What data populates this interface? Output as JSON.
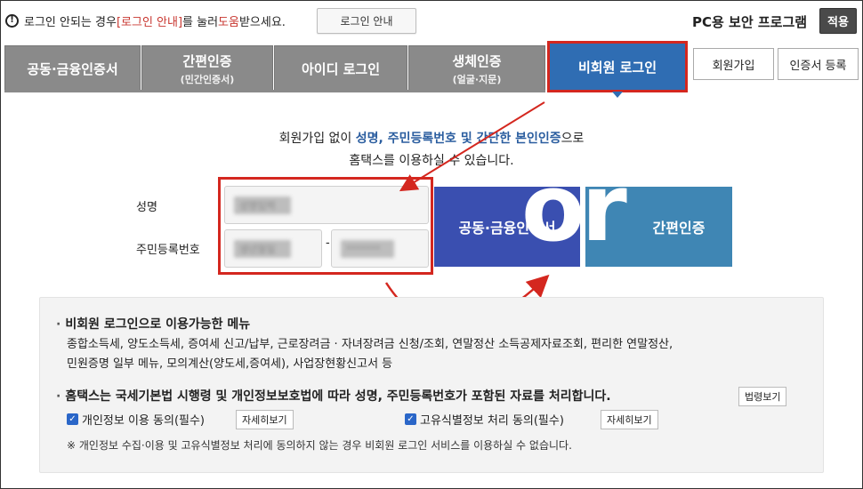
{
  "notice": {
    "icon": "warning-icon",
    "prefix": "로그인 안되는 경우 ",
    "link": "[로그인 안내]",
    "middle": "를 눌러 ",
    "help": "도움",
    "suffix": "받으세요.",
    "button": "로그인 안내"
  },
  "security": {
    "title": "PC용 보안 프로그램",
    "apply": "적용"
  },
  "tabs": [
    {
      "label": "공동·금융인증서",
      "sub": ""
    },
    {
      "label": "간편인증",
      "sub": "(민간인증서)"
    },
    {
      "label": "아이디 로그인",
      "sub": ""
    },
    {
      "label": "생체인증",
      "sub": "(얼굴·지문)"
    },
    {
      "label": "비회원 로그인",
      "sub": ""
    }
  ],
  "side_buttons": {
    "join": "회원가입",
    "cert_register": "인증서 등록"
  },
  "intro": {
    "line1_prefix": "회원가입 없이 ",
    "line1_blue": "성명, 주민등록번호 및 간단한 본인인증",
    "line1_suffix": "으로",
    "line2": "홈택스를 이용하실 수 있습니다."
  },
  "form": {
    "name_label": "성명",
    "rrn_label": "주민등록번호",
    "name_placeholder": "성명입력",
    "rrn_front_placeholder": "생년월일",
    "rrn_back_placeholder": "*******",
    "dash": "-"
  },
  "auth_buttons": {
    "cert": "공동·금융인증서",
    "easy": "간편인증",
    "or": "or"
  },
  "info": {
    "menu_title": "비회원 로그인으로 이용가능한 메뉴",
    "menu_line1": "종합소득세, 양도소득세, 증여세 신고/납부, 근로장려금 · 자녀장려금 신청/조회, 연말정산 소득공제자료조회, 편리한 연말정산,",
    "menu_line2": "민원증명 일부 메뉴, 모의계산(양도세,증여세), 사업장현황신고서 등",
    "law_title": "홈택스는 국세기본법 시행령 및 개인정보보호법에 따라 성명, 주민등록번호가 포함된 자료를 처리합니다.",
    "law_button": "법령보기",
    "consent1": "개인정보 이용 동의(필수)",
    "consent2": "고유식별정보 처리 동의(필수)",
    "detail_button": "자세히보기",
    "note": "※ 개인정보 수집·이용 및 고유식별정보 처리에 동의하지 않는 경우 비회원 로그인 서비스를 이용하실 수 없습니다."
  },
  "colors": {
    "active_tab": "#2f6db3",
    "highlight": "#d4271f",
    "cert_btn": "#3a4fb0",
    "easy_btn": "#3f86b4"
  }
}
